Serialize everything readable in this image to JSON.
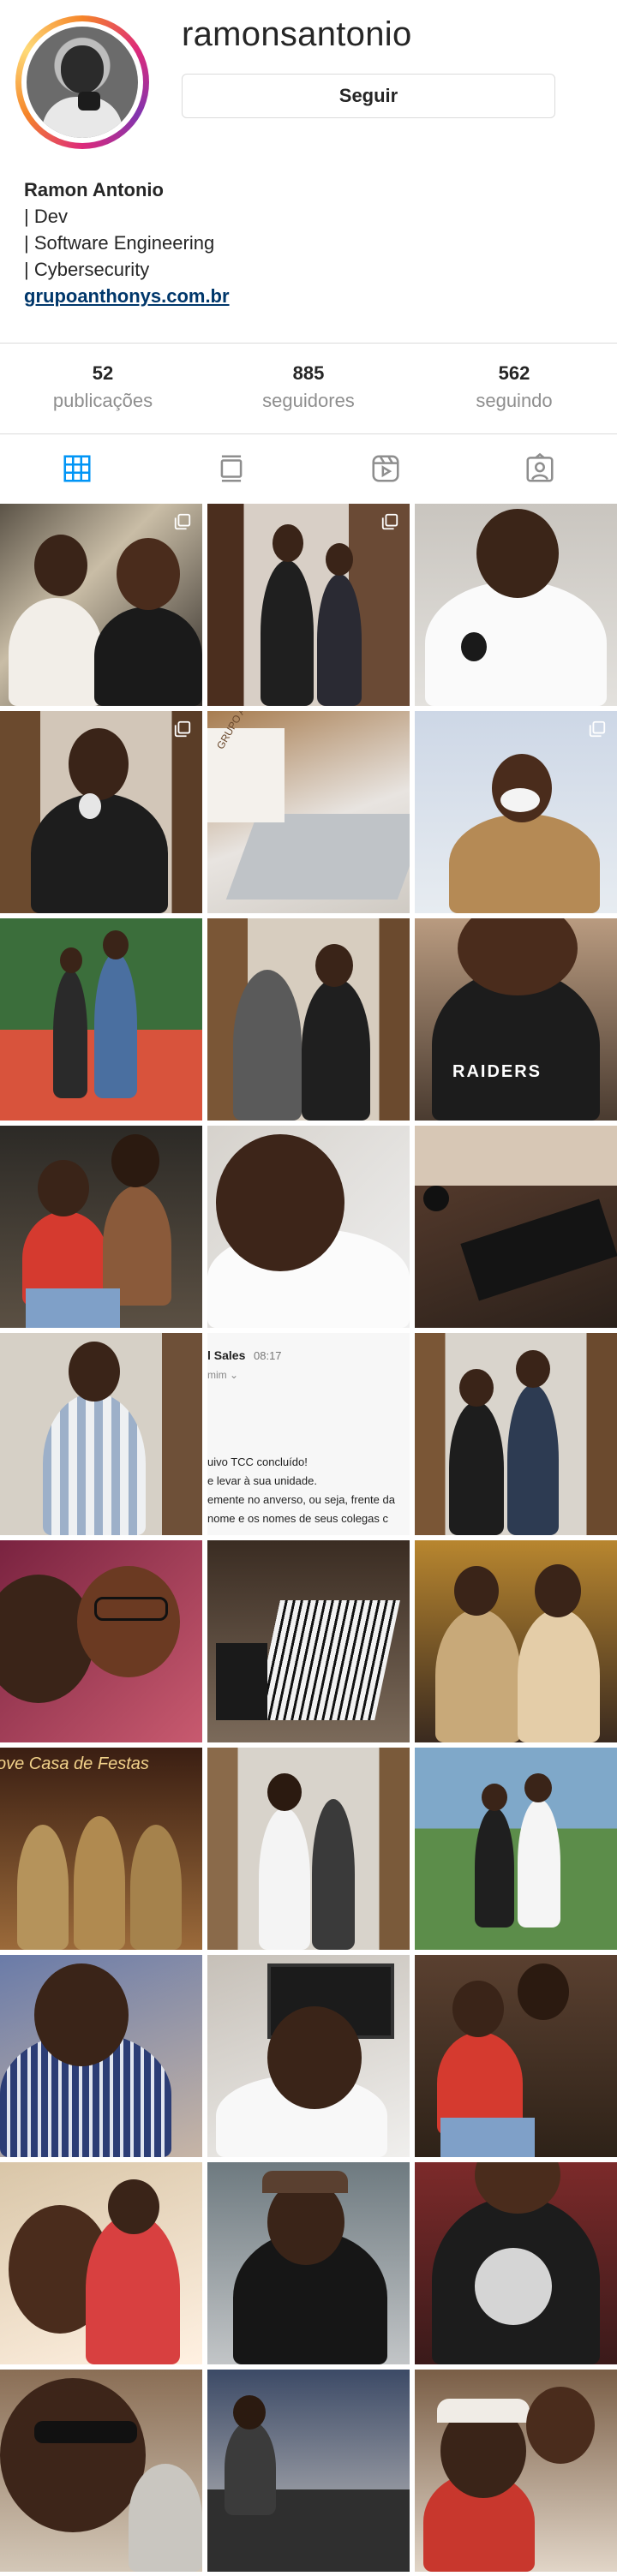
{
  "profile": {
    "username": "ramonsantonio",
    "follow_label": "Seguir",
    "name": "Ramon Antonio",
    "bio_lines": [
      "| Dev",
      "| Software Engineering",
      "| Cybersecurity"
    ],
    "link": "grupoanthonys.com.br"
  },
  "stats": {
    "posts": {
      "value": "52",
      "label": "publicações"
    },
    "followers": {
      "value": "885",
      "label": "seguidores"
    },
    "following": {
      "value": "562",
      "label": "seguindo"
    }
  },
  "tabs": [
    {
      "icon": "grid-icon",
      "active": true
    },
    {
      "icon": "feed-icon",
      "active": false
    },
    {
      "icon": "reels-icon",
      "active": false
    },
    {
      "icon": "tagged-icon",
      "active": false
    }
  ],
  "colors": {
    "active_tab": "#0095f6",
    "inactive_tab": "#8e8e8e",
    "link": "#00376b",
    "muted": "#8e8e8e"
  },
  "grid": {
    "multi_photo_indices": [
      0,
      1,
      3,
      5
    ],
    "message_post": {
      "name": "l Sales",
      "time": "08:17",
      "sub": "mim ⌄",
      "lines": [
        "uivo TCC concluído!",
        "e levar à sua unidade.",
        "emente no anverso, ou seja, frente da",
        "nome e os nomes de seus colegas c"
      ]
    },
    "sign_texts": {
      "grupo": "GRUPO ANTHONY'S",
      "raiders": "RAIDERS",
      "festa": "ove Casa de Festas"
    }
  }
}
